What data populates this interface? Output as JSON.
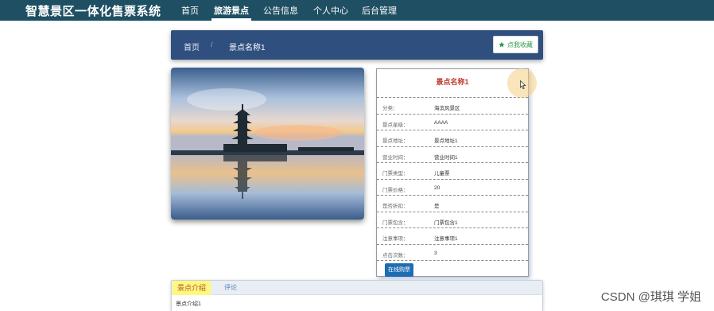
{
  "header": {
    "brand": "智慧景区一体化售票系统",
    "nav": [
      {
        "label": "首页"
      },
      {
        "label": "旅游景点"
      },
      {
        "label": "公告信息"
      },
      {
        "label": "个人中心"
      },
      {
        "label": "后台管理"
      }
    ],
    "active_index": 1
  },
  "breadcrumb": {
    "home": "首页",
    "separator": "/",
    "current": "景点名称1",
    "favorite_label": "点我收藏"
  },
  "detail": {
    "title": "景点名称1",
    "rows": [
      {
        "label": "分类：",
        "value": "海滨风景区"
      },
      {
        "label": "景点星级：",
        "value": "AAAA"
      },
      {
        "label": "景点地址：",
        "value": "景点地址1"
      },
      {
        "label": "营业时间：",
        "value": "营业时间1"
      },
      {
        "label": "门票类型：",
        "value": "儿童票"
      },
      {
        "label": "门票价格：",
        "value": "20"
      },
      {
        "label": "是否折扣：",
        "value": "是"
      },
      {
        "label": "门票包含：",
        "value": "门票包含1"
      },
      {
        "label": "注意事项：",
        "value": "注意事项1"
      },
      {
        "label": "点击次数：",
        "value": "3"
      }
    ],
    "buy_label": "在线购票"
  },
  "tabs": {
    "items": [
      {
        "label": "景点介绍"
      },
      {
        "label": "评论"
      }
    ],
    "content": "景点介绍1"
  },
  "watermark": "CSDN @琪琪 学姐",
  "colors": {
    "nav_bg": "#1f4f63",
    "crumb_bg": "#2f4f7f",
    "title_red": "#c0392b",
    "buy_blue": "#1d6db3",
    "fav_green": "#2e9e4a",
    "tab_active_bg": "#fdf97a"
  }
}
